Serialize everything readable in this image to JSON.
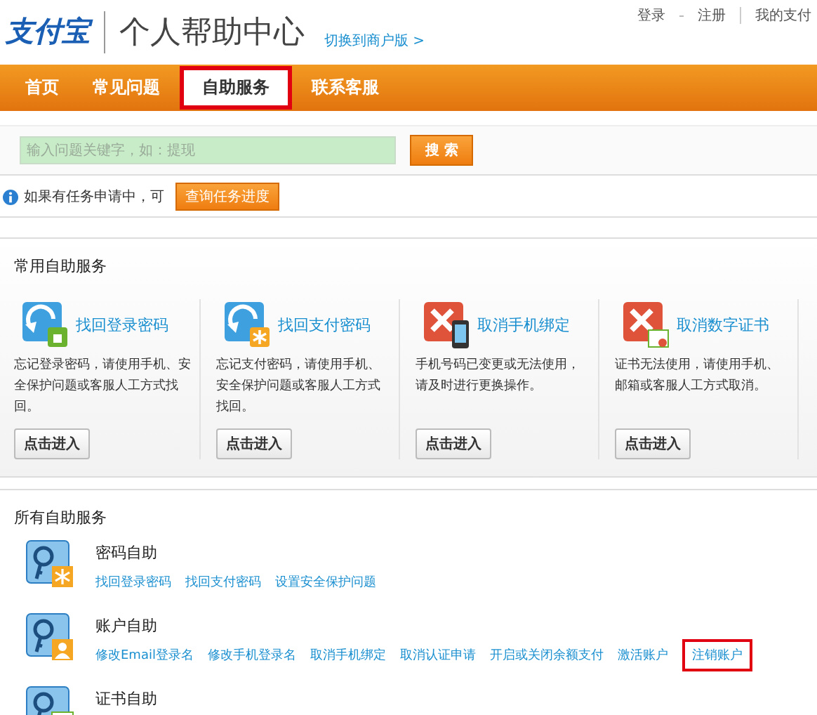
{
  "header": {
    "logo": "支付宝",
    "title": "个人帮助中心",
    "switch_link": "切换到商户版 >",
    "top_links": [
      "登录",
      "注册",
      "我的支付"
    ]
  },
  "nav": [
    {
      "label": "首页",
      "selected": false
    },
    {
      "label": "常见问题",
      "selected": false
    },
    {
      "label": "自助服务",
      "selected": true
    },
    {
      "label": "联系客服",
      "selected": false
    }
  ],
  "search": {
    "placeholder": "输入问题关键字，如：提现",
    "button": "搜 索"
  },
  "notice": {
    "text": "如果有任务申请中，可",
    "button": "查询任务进度"
  },
  "common": {
    "title": "常用自助服务",
    "cards": [
      {
        "kind": "refresh-lock",
        "title": "找回登录密码",
        "desc": "忘记登录密码，请使用手机、安全保护问题或客服人工方式找回。",
        "button": "点击进入"
      },
      {
        "kind": "refresh-star",
        "title": "找回支付密码",
        "desc": "忘记支付密码，请使用手机、安全保护问题或客服人工方式找回。",
        "button": "点击进入"
      },
      {
        "kind": "cancel-phone",
        "title": "取消手机绑定",
        "desc": "手机号码已变更或无法使用，请及时进行更换操作。",
        "button": "点击进入"
      },
      {
        "kind": "cancel-cert",
        "title": "取消数字证书",
        "desc": "证书无法使用，请使用手机、邮箱或客服人工方式取消。",
        "button": "点击进入"
      }
    ]
  },
  "all": {
    "title": "所有自助服务",
    "groups": [
      {
        "kind": "star",
        "title": "密码自助",
        "links": [
          {
            "label": "找回登录密码",
            "highlighted": false
          },
          {
            "label": "找回支付密码",
            "highlighted": false
          },
          {
            "label": "设置安全保护问题",
            "highlighted": false
          }
        ]
      },
      {
        "kind": "person",
        "title": "账户自助",
        "links": [
          {
            "label": "修改Email登录名",
            "highlighted": false
          },
          {
            "label": "修改手机登录名",
            "highlighted": false
          },
          {
            "label": "取消手机绑定",
            "highlighted": false
          },
          {
            "label": "取消认证申请",
            "highlighted": false
          },
          {
            "label": "开启或关闭余额支付",
            "highlighted": false
          },
          {
            "label": "激活账户",
            "highlighted": false
          },
          {
            "label": "注销账户",
            "highlighted": true
          }
        ]
      },
      {
        "kind": "cert",
        "title": "证书自助"
      }
    ]
  }
}
